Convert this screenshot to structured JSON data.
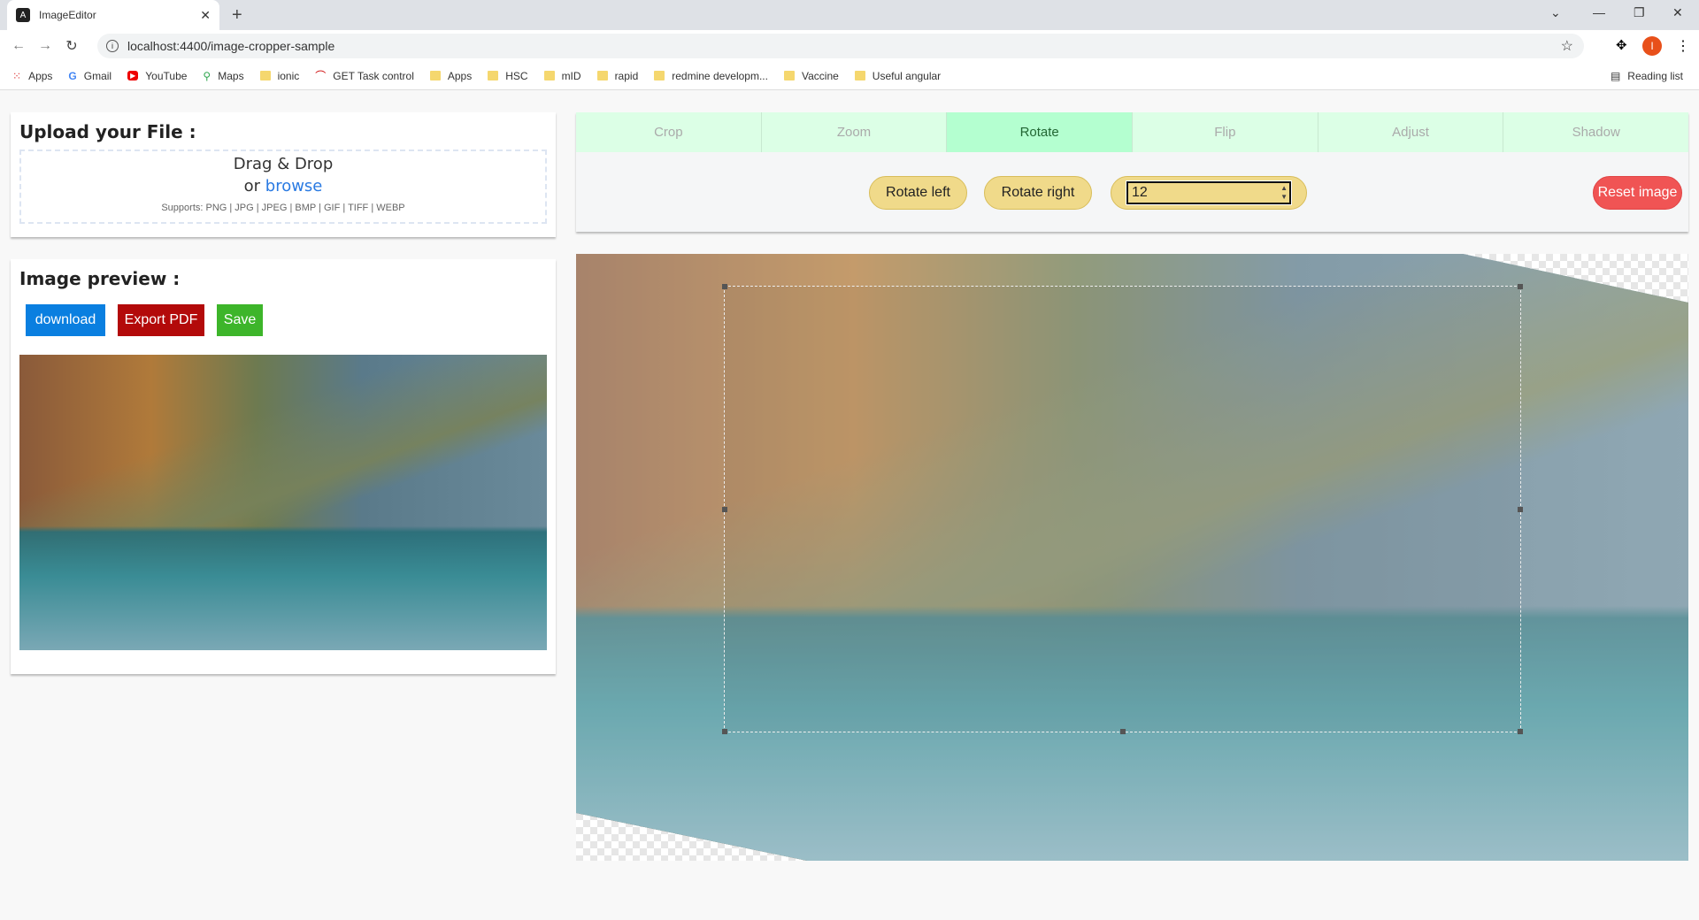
{
  "browser": {
    "tab_title": "ImageEditor",
    "url": "localhost:4400/image-cropper-sample",
    "bookmarks": [
      "Apps",
      "Gmail",
      "YouTube",
      "Maps",
      "ionic",
      "GET Task control",
      "Apps",
      "HSC",
      "mID",
      "rapid",
      "redmine developm...",
      "Vaccine",
      "Useful angular"
    ],
    "reading_list": "Reading list",
    "profile_initial": "I"
  },
  "upload": {
    "title": "Upload your File :",
    "drag": "Drag & Drop",
    "or": "or",
    "browse": "browse",
    "supports": "Supports: PNG | JPG | JPEG | BMP | GIF | TIFF | WEBP"
  },
  "preview": {
    "title": "Image preview :",
    "download": "download",
    "export_pdf": "Export PDF",
    "save": "Save"
  },
  "editor": {
    "tabs": [
      "Crop",
      "Zoom",
      "Rotate",
      "Flip",
      "Adjust",
      "Shadow"
    ],
    "active_tab": "Rotate",
    "rotate_left": "Rotate left",
    "rotate_right": "Rotate right",
    "angle_value": "12",
    "reset": "Reset image"
  },
  "colors": {
    "download": "#0a7fe0",
    "export": "#b30a0a",
    "save": "#3db52a",
    "reset": "#f05454",
    "tab_active": "#b4ffd0",
    "tab": "#dcffe6",
    "pill": "#f0da8a"
  }
}
